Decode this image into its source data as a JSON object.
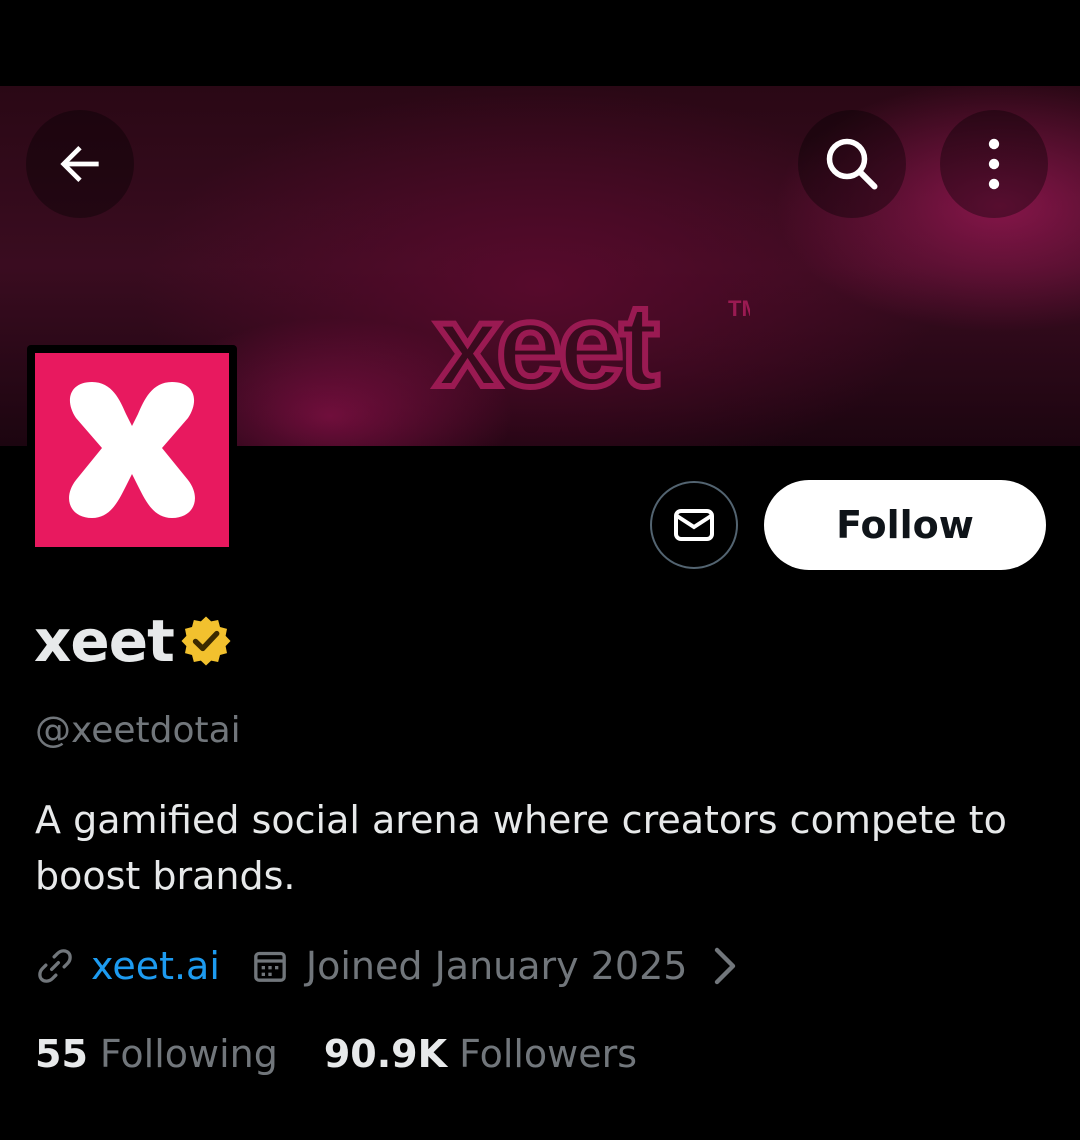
{
  "header": {
    "back_icon": "arrow-left-icon",
    "search_icon": "search-icon",
    "more_icon": "more-vertical-icon",
    "banner_wordmark": "xeet"
  },
  "profile": {
    "display_name": "xeet",
    "verified_badge": "verified-gold-icon",
    "handle": "@xeetdotai",
    "bio": "A gamified social arena where creators compete to boost brands.",
    "website": "xeet.ai",
    "joined": "Joined January 2025",
    "following_count": "55",
    "following_label": "Following",
    "followers_count": "90.9K",
    "followers_label": "Followers"
  },
  "actions": {
    "message_icon": "mail-icon",
    "follow_label": "Follow"
  },
  "colors": {
    "brand_pink": "#e8195f",
    "link_blue": "#1d9bf0",
    "verified_gold": "#f2c12e",
    "muted_text": "#71767b"
  }
}
